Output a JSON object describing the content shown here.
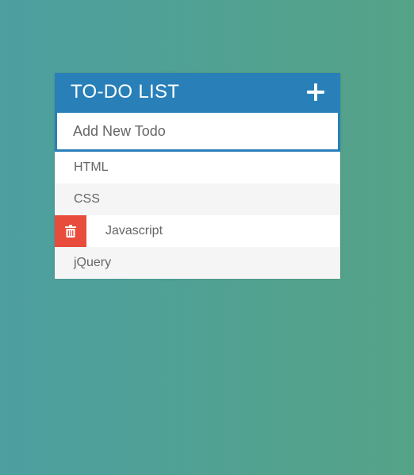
{
  "header": {
    "title": "TO-DO LIST"
  },
  "input": {
    "placeholder": "Add New Todo",
    "value": ""
  },
  "todos": [
    {
      "text": "HTML",
      "hovered": false
    },
    {
      "text": "CSS",
      "hovered": false
    },
    {
      "text": "Javascript",
      "hovered": true
    },
    {
      "text": "jQuery",
      "hovered": false
    }
  ],
  "icons": {
    "add": "plus-icon",
    "delete": "trash-icon"
  },
  "colors": {
    "header": "#2980b9",
    "delete": "#e74c3c",
    "background_start": "#4d9fa0",
    "background_end": "#55a387",
    "row_alt": "#f5f5f5"
  }
}
